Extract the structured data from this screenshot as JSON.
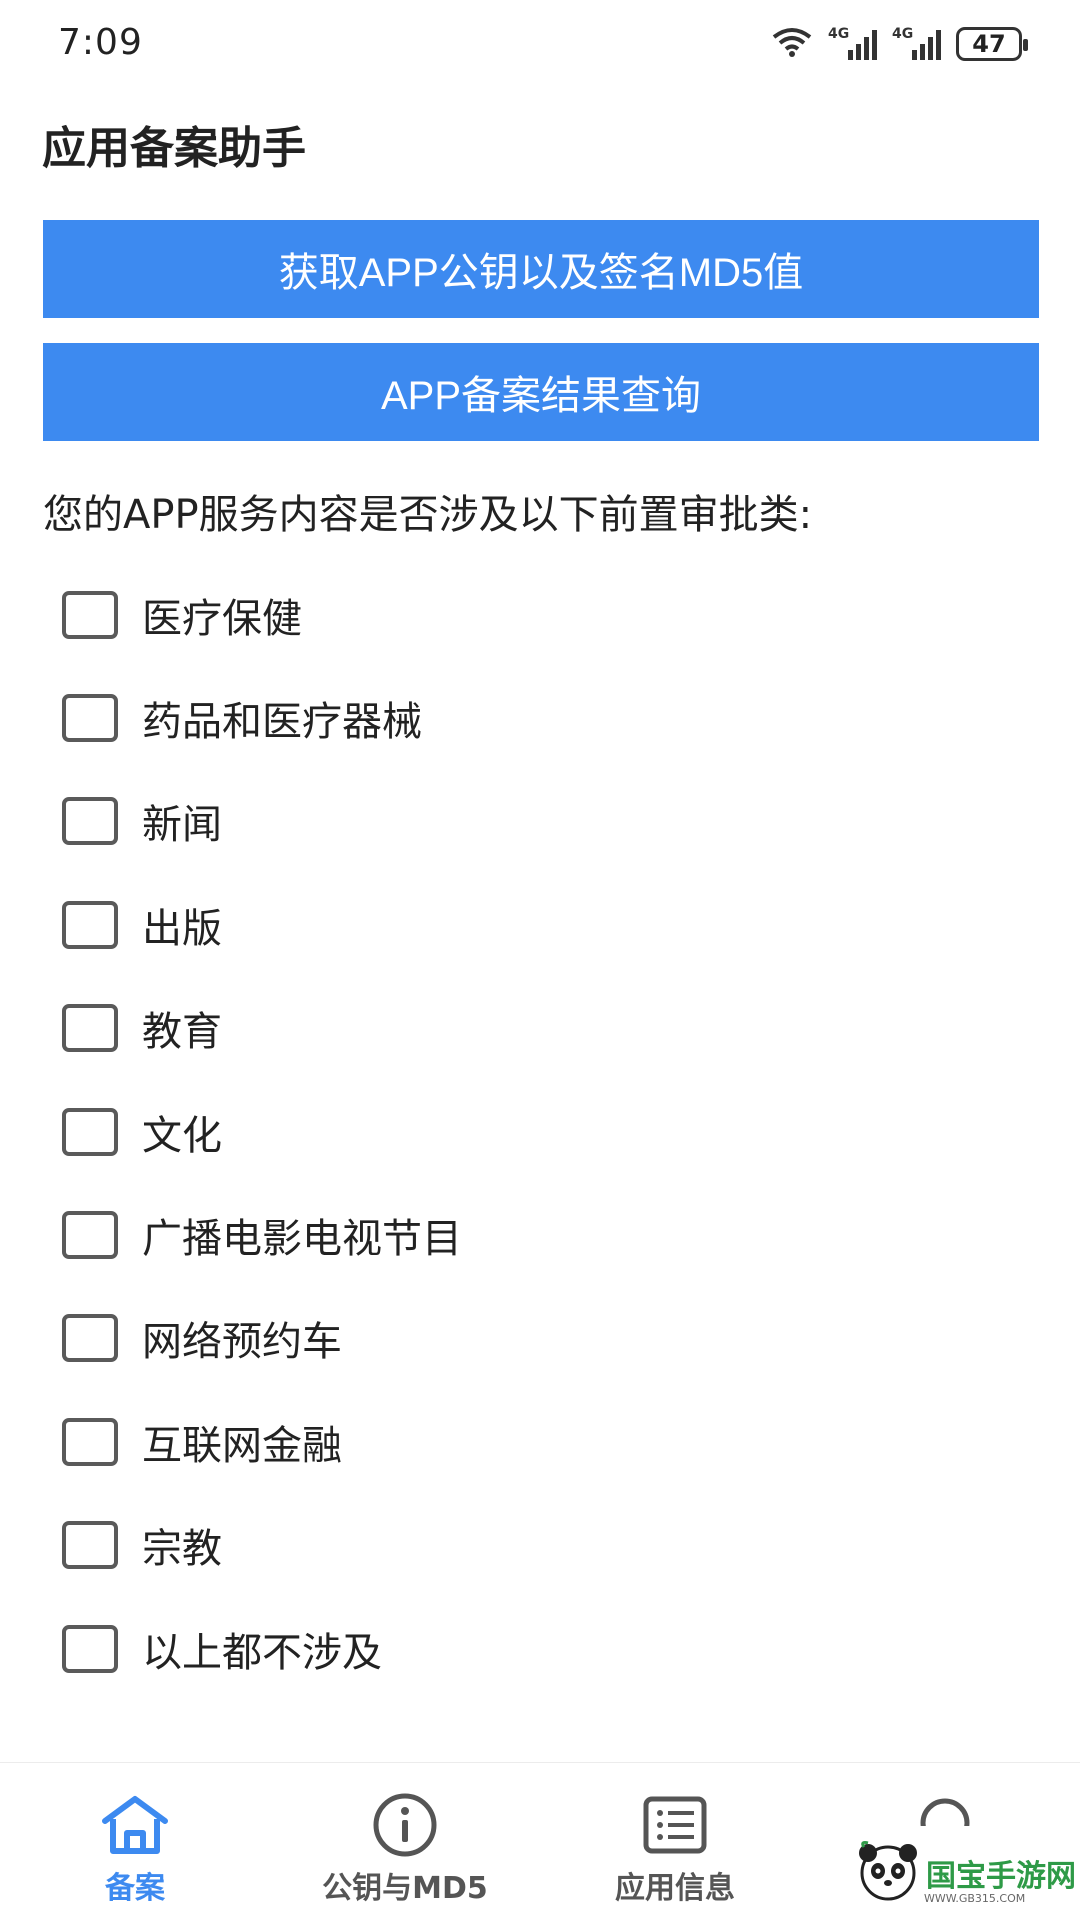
{
  "status_bar": {
    "time": "7:09",
    "battery": "47",
    "signal_label_1": "4G",
    "signal_label_2": "4G",
    "icons": [
      "wifi-icon",
      "signal-4g-icon",
      "signal-4g-icon",
      "battery-icon"
    ]
  },
  "header": {
    "title": "应用备案助手"
  },
  "actions": {
    "get_key_label": "获取APP公钥以及签名MD5值",
    "query_label": "APP备案结果查询"
  },
  "question": "您的APP服务内容是否涉及以下前置审批类:",
  "options": [
    {
      "label": "医疗保健",
      "checked": false
    },
    {
      "label": "药品和医疗器械",
      "checked": false
    },
    {
      "label": "新闻",
      "checked": false
    },
    {
      "label": "出版",
      "checked": false
    },
    {
      "label": "教育",
      "checked": false
    },
    {
      "label": "文化",
      "checked": false
    },
    {
      "label": "广播电影电视节目",
      "checked": false
    },
    {
      "label": "网络预约车",
      "checked": false
    },
    {
      "label": "互联网金融",
      "checked": false
    },
    {
      "label": "宗教",
      "checked": false
    },
    {
      "label": "以上都不涉及",
      "checked": false
    }
  ],
  "bottom_nav": [
    {
      "label": "备案",
      "icon": "home-icon",
      "active": true
    },
    {
      "label": "公钥与MD5",
      "icon": "info-icon",
      "active": false
    },
    {
      "label": "应用信息",
      "icon": "list-icon",
      "active": false
    },
    {
      "label": "",
      "icon": "profile-icon",
      "active": false
    }
  ],
  "watermark": {
    "text": "国宝手游网",
    "sub": "WWW.GB315.COM"
  },
  "colors": {
    "accent": "#3d8af0",
    "text": "#222222",
    "checkbox_border": "#5a5a5a"
  }
}
